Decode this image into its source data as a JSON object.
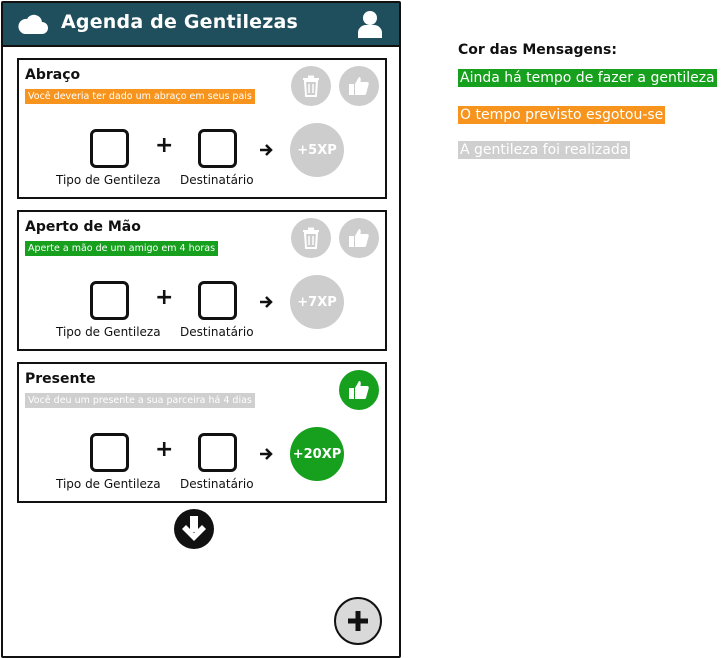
{
  "header": {
    "title": "Agenda de Gentilezas",
    "icons": [
      "cloud-icon",
      "user-icon"
    ]
  },
  "cards": [
    {
      "title": "Abraço",
      "message": "Você deveria ter dado um abraço em seus pais",
      "status": "orange",
      "xp": "+5XP",
      "label_type": "Tipo de Gentileza",
      "label_dest": "Destinatário"
    },
    {
      "title": "Aperto de Mão",
      "message": "Aperte a mão de um amigo em 4 horas",
      "status": "green",
      "xp": "+7XP",
      "label_type": "Tipo de Gentileza",
      "label_dest": "Destinatário"
    },
    {
      "title": "Presente",
      "message": "Você deu um presente a sua parceira há 4 dias",
      "status": "gray",
      "xp": "+20XP",
      "label_type": "Tipo de Gentileza",
      "label_dest": "Destinatário"
    }
  ],
  "legend": {
    "title": "Cor das Mensagens:",
    "items": [
      {
        "text": "Ainda há tempo de fazer a gentileza",
        "color": "#16a01e"
      },
      {
        "text": "O tempo previsto esgotou-se",
        "color": "#f7941d"
      },
      {
        "text": "A gentileza foi realizada",
        "color": "#cfcfcf"
      }
    ]
  },
  "colors": {
    "header": "#1f4f5c",
    "green": "#16a01e",
    "orange": "#f7941d",
    "gray": "#cfcfcf"
  }
}
